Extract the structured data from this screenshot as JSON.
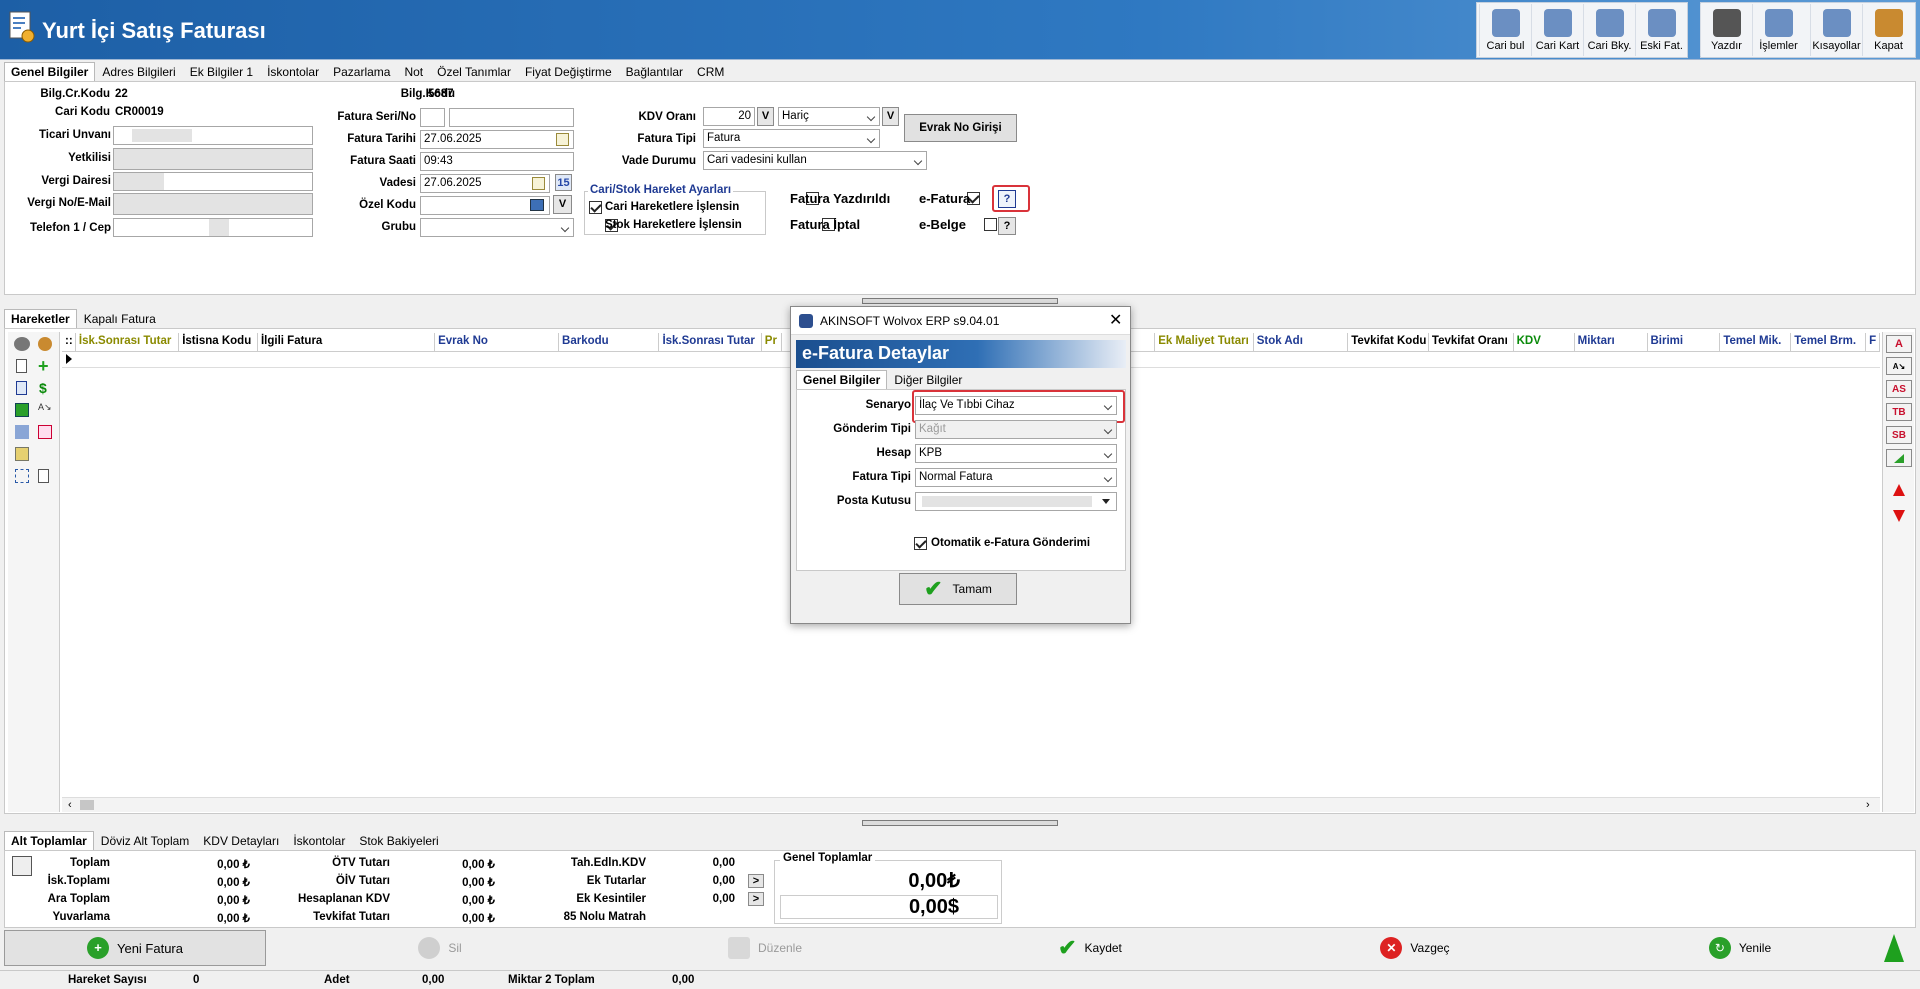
{
  "window": {
    "title": "Yurt İçi Satış Faturası"
  },
  "toolbar": [
    {
      "label": "Cari bul",
      "icon": "person-search-icon"
    },
    {
      "label": "Cari Kart",
      "icon": "person-card-icon"
    },
    {
      "label": "Cari Bky.",
      "icon": "person-balance-icon"
    },
    {
      "label": "Eski Fat.",
      "icon": "old-invoice-icon"
    },
    {
      "label": "Yazdır",
      "icon": "printer-icon"
    },
    {
      "label": "İşlemler",
      "icon": "operations-icon"
    },
    {
      "label": "Kısayollar",
      "icon": "shortcuts-icon"
    },
    {
      "label": "Kapat",
      "icon": "exit-door-icon"
    }
  ],
  "main_tabs": [
    "Genel Bilgiler",
    "Adres Bilgileri",
    "Ek Bilgiler 1",
    "İskontolar",
    "Pazarlama",
    "Not",
    "Özel Tanımlar",
    "Fiyat Değiştirme",
    "Bağlantılar",
    "CRM"
  ],
  "left": {
    "bilg_cr_kodu_label": "Bilg.Cr.Kodu",
    "bilg_cr_kodu": "22",
    "cari_kodu_label": "Cari Kodu",
    "cari_kodu": "CR00019",
    "ticari_unvan": "Ticari Unvanı",
    "yetkilisi": "Yetkilisi",
    "vergi_dairesi": "Vergi Dairesi",
    "vergi_no": "Vergi No/E-Mail",
    "telefon": "Telefon 1 / Cep"
  },
  "middle": {
    "bilg_kodu_label": "Bilg.Kodu",
    "bilg_kodu": "5687",
    "fatura_seri_label": "Fatura Seri/No",
    "fatura_tarihi_label": "Fatura Tarihi",
    "fatura_tarihi": "27.06.2025",
    "fatura_saati_label": "Fatura Saati",
    "fatura_saati": "09:43",
    "vadesi_label": "Vadesi",
    "vadesi": "27.06.2025",
    "ozel_kodu_label": "Özel Kodu",
    "grubu_label": "Grubu"
  },
  "right": {
    "kdv_orani_label": "KDV Oranı",
    "kdv_orani": "20",
    "kdv_v": "V",
    "kdv_haric": "Hariç",
    "fatura_tipi_label": "Fatura Tipi",
    "fatura_tipi": "Fatura",
    "vade_durumu_label": "Vade Durumu",
    "vade_durumu": "Cari vadesini kullan",
    "evrak_no_btn": "Evrak No Girişi",
    "hareket_ayarlari": "Cari/Stok Hareket Ayarları",
    "cari_hareket": "Cari Hareketlere İşlensin",
    "stok_hareket": "Stok Hareketlere İşlensin",
    "fatura_yazdirildi": "Fatura Yazdırıldı",
    "fatura_iptal": "Fatura İptal",
    "e_fatura": "e-Fatura",
    "e_belge": "e-Belge",
    "q": "?"
  },
  "detail_tabs": [
    "Hareketler",
    "Kapalı Fatura"
  ],
  "grid_columns": [
    {
      "label": "İsk.Sonrası Tutar",
      "color": "#8a8a00",
      "w": 105
    },
    {
      "label": "İstisna Kodu",
      "color": "#000",
      "w": 80
    },
    {
      "label": "İlgili Fatura",
      "color": "#000",
      "w": 180
    },
    {
      "label": "Evrak No",
      "color": "#1f3a93",
      "w": 126
    },
    {
      "label": "Barkodu",
      "color": "#1f3a93",
      "w": 102
    },
    {
      "label": "İsk.Sonrası Tutar",
      "color": "#1f3a93",
      "w": 104
    },
    {
      "label": "Pr",
      "color": "#8a8a00",
      "w": 20
    },
    {
      "label": "",
      "color": "#000",
      "w": 380
    },
    {
      "label": "Ek Maliyet Tutarı",
      "color": "#8a8a00",
      "w": 100
    },
    {
      "label": "Stok Adı",
      "color": "#1f3a93",
      "w": 96
    },
    {
      "label": "Tevkifat Kodu",
      "color": "#000",
      "w": 82
    },
    {
      "label": "Tevkifat Oranı",
      "color": "#000",
      "w": 86
    },
    {
      "label": "KDV",
      "color": "#0a8a0a",
      "w": 62
    },
    {
      "label": "Miktarı",
      "color": "#1f3a93",
      "w": 74
    },
    {
      "label": "Birimi",
      "color": "#1f3a93",
      "w": 74
    },
    {
      "label": "Temel Mik.",
      "color": "#1f3a93",
      "w": 72
    },
    {
      "label": "Temel Brm.",
      "color": "#1f3a93",
      "w": 76
    },
    {
      "label": "F",
      "color": "#1f3a93",
      "w": 14
    }
  ],
  "side_buttons": [
    "A",
    "AS",
    "TB",
    "SB"
  ],
  "totals_tabs": [
    "Alt Toplamlar",
    "Döviz Alt Toplam",
    "KDV Detayları",
    "İskontolar",
    "Stok Bakiyeleri"
  ],
  "totals_col1": [
    {
      "l": "Toplam",
      "v": "0,00 ₺"
    },
    {
      "l": "İsk.Toplamı",
      "v": "0,00 ₺"
    },
    {
      "l": "Ara Toplam",
      "v": "0,00 ₺"
    },
    {
      "l": "Yuvarlama",
      "v": "0,00 ₺"
    }
  ],
  "totals_col2": [
    {
      "l": "ÖTV Tutarı",
      "v": "0,00 ₺"
    },
    {
      "l": "ÖİV Tutarı",
      "v": "0,00 ₺"
    },
    {
      "l": "Hesaplanan KDV",
      "v": "0,00 ₺"
    },
    {
      "l": "Tevkifat Tutarı",
      "v": "0,00 ₺"
    }
  ],
  "totals_col3": [
    {
      "l": "Tah.Edln.KDV",
      "v": "0,00"
    },
    {
      "l": "Ek Tutarlar",
      "v": "0,00"
    },
    {
      "l": "Ek Kesintiler",
      "v": "0,00"
    },
    {
      "l": "85 Nolu Matrah",
      "v": ""
    }
  ],
  "genel": {
    "title": "Genel Toplamlar",
    "tl": "0,00₺",
    "usd": "0,00$"
  },
  "actions": {
    "yeni": "Yeni Fatura",
    "sil": "Sil",
    "duzenle": "Düzenle",
    "kaydet": "Kaydet",
    "vazgec": "Vazgeç",
    "yenile": "Yenile"
  },
  "status": {
    "hareket_label": "Hareket Sayısı",
    "hareket": "0",
    "adet_label": "Adet",
    "adet": "0,00",
    "miktar2_label": "Miktar 2 Toplam",
    "miktar2": "0,00"
  },
  "modal": {
    "window_title": "AKINSOFT Wolvox ERP s9.04.01",
    "header": "e-Fatura Detaylar",
    "tabs": [
      "Genel Bilgiler",
      "Diğer Bilgiler"
    ],
    "senaryo_label": "Senaryo",
    "senaryo": "İlaç Ve Tıbbi Cihaz",
    "gonderim_label": "Gönderim Tipi",
    "gonderim": "Kağıt",
    "hesap_label": "Hesap",
    "hesap": "KPB",
    "fatura_tipi_label": "Fatura Tipi",
    "fatura_tipi": "Normal Fatura",
    "posta_label": "Posta Kutusu",
    "otomatik": "Otomatik e-Fatura Gönderimi",
    "ok": "Tamam"
  }
}
